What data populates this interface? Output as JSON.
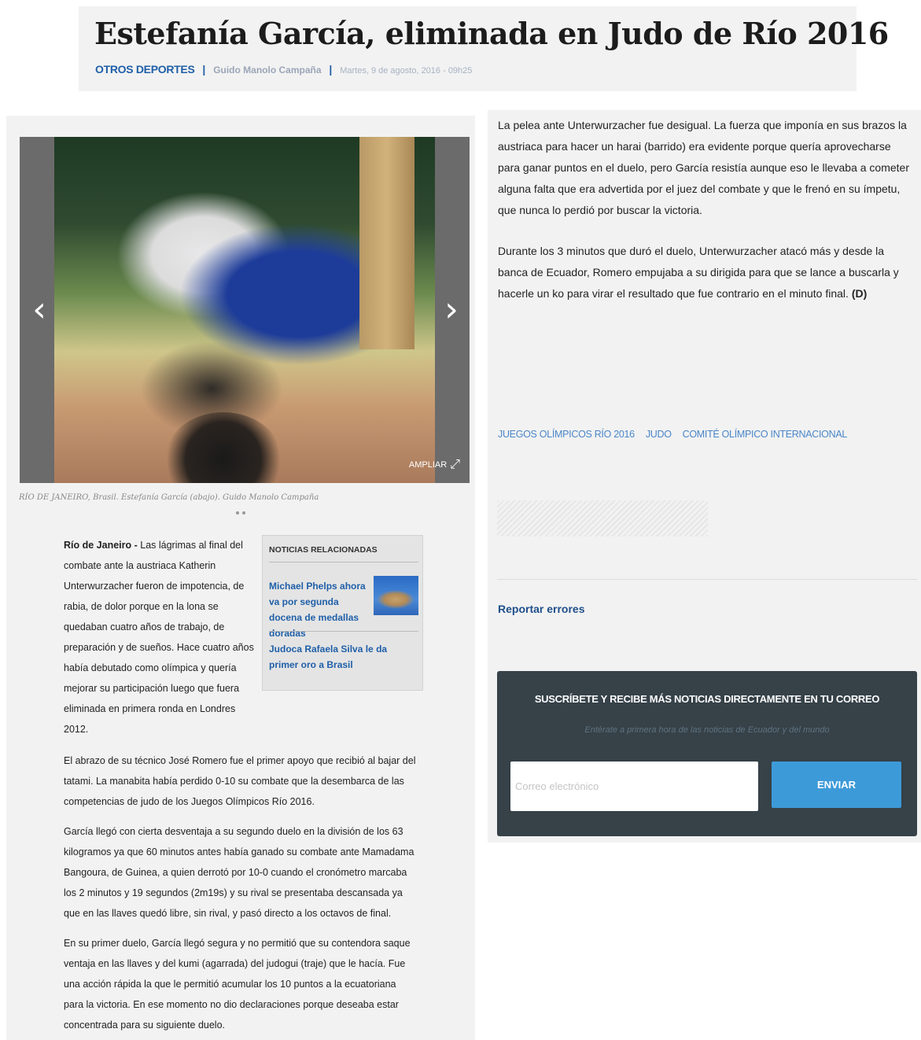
{
  "header": {
    "title": "Estefanía García, eliminada en Judo de Río 2016",
    "section": "OTROS DEPORTES",
    "separator": "|",
    "author": "Guido Manolo Campaña",
    "date": "Martes, 9 de agosto, 2016 - 09h25"
  },
  "gallery": {
    "ampliar_label": "AMPLIAR",
    "prev_icon": "chevron-left-icon",
    "next_icon": "chevron-right-icon",
    "expand_icon": "expand-icon",
    "caption": "RÍO DE JANEIRO, Brasil. Estefanía García (abajo). Guido Manolo Campaña",
    "dots": 2
  },
  "article": {
    "lead_place": "Río de Janeiro -",
    "lead_text": " Las lágrimas al final del combate ante la austriaca Katherin Unterwurzacher fueron de impotencia, de rabia, de dolor porque en la lona se quedaban cuatro años de trabajo, de preparación y de sueños. Hace cuatro años había debutado como olímpica y quería mejorar su participación luego que fuera eliminada en primera ronda en Londres 2012.",
    "paragraphs": [
      "El abrazo de su técnico José Romero fue el primer apoyo que recibió al bajar del tatami. La manabita había perdido 0-10 su combate que la desembarca de las competencias de judo de los Juegos Olímpicos Río 2016.",
      "García llegó con cierta desventaja a su segundo duelo en la división de los 63 kilogramos ya que 60 minutos antes había ganado su combate ante Mamadama Bangoura, de Guinea, a quien derrotó por 10-0 cuando el cronómetro marcaba los 2 minutos y 19 segundos (2m19s) y su rival se presentaba descansada ya que en las llaves quedó libre, sin rival, y pasó directo a los octavos de final.",
      "En su primer duelo, García llegó segura y no permitió que su contendora saque ventaja en las llaves y del kumi (agarrada) del judogui (traje) que le hacía. Fue una acción rápida la que le permitió acumular los 10 puntos a la ecuatoriana para la victoria. En ese momento no dio declaraciones porque deseaba estar concentrada para su siguiente duelo."
    ]
  },
  "related": {
    "title": "NOTICIAS RELACIONADAS",
    "items": [
      "Michael Phelps ahora va por segunda docena de medallas doradas",
      "Judoca Rafaela Silva le da primer oro a Brasil"
    ]
  },
  "right": {
    "paragraph1": "La pelea ante Unterwurzacher fue desigual. La fuerza que imponía en sus brazos la austriaca para hacer un harai (barrido) era evidente porque quería aprovecharse para ganar puntos en el duelo, pero García resistía aunque eso le llevaba a cometer alguna falta que era advertida por el juez del combate y que le frenó en su ímpetu, que nunca lo perdió por buscar la victoria.",
    "paragraph2": "Durante los 3 minutos que duró el duelo, Unterwurzacher atacó más y desde la banca de Ecuador, Romero empujaba a su dirigida para que se lance a buscarla y hacerle un ko para virar el resultado que fue contrario en el minuto final.",
    "signature": "(D)",
    "tags": [
      "JUEGOS OLÍMPICOS RÍO 2016",
      "JUDO",
      "COMITÉ OLÍMPICO INTERNACIONAL"
    ],
    "report_label": "Reportar errores"
  },
  "subscribe": {
    "title": "SUSCRÍBETE Y RECIBE MÁS NOTICIAS DIRECTAMENTE EN TU CORREO",
    "subtitle": "Entérate a primera hora de las noticias de Ecuador y del mundo",
    "email_placeholder": "Correo electrónico",
    "email_value": "",
    "button_label": "ENVIAR"
  },
  "colors": {
    "link_blue": "#1f5fa8",
    "tag_blue": "#4a86c8",
    "subscribe_bg": "#364148",
    "button_blue": "#3d9ad9"
  }
}
